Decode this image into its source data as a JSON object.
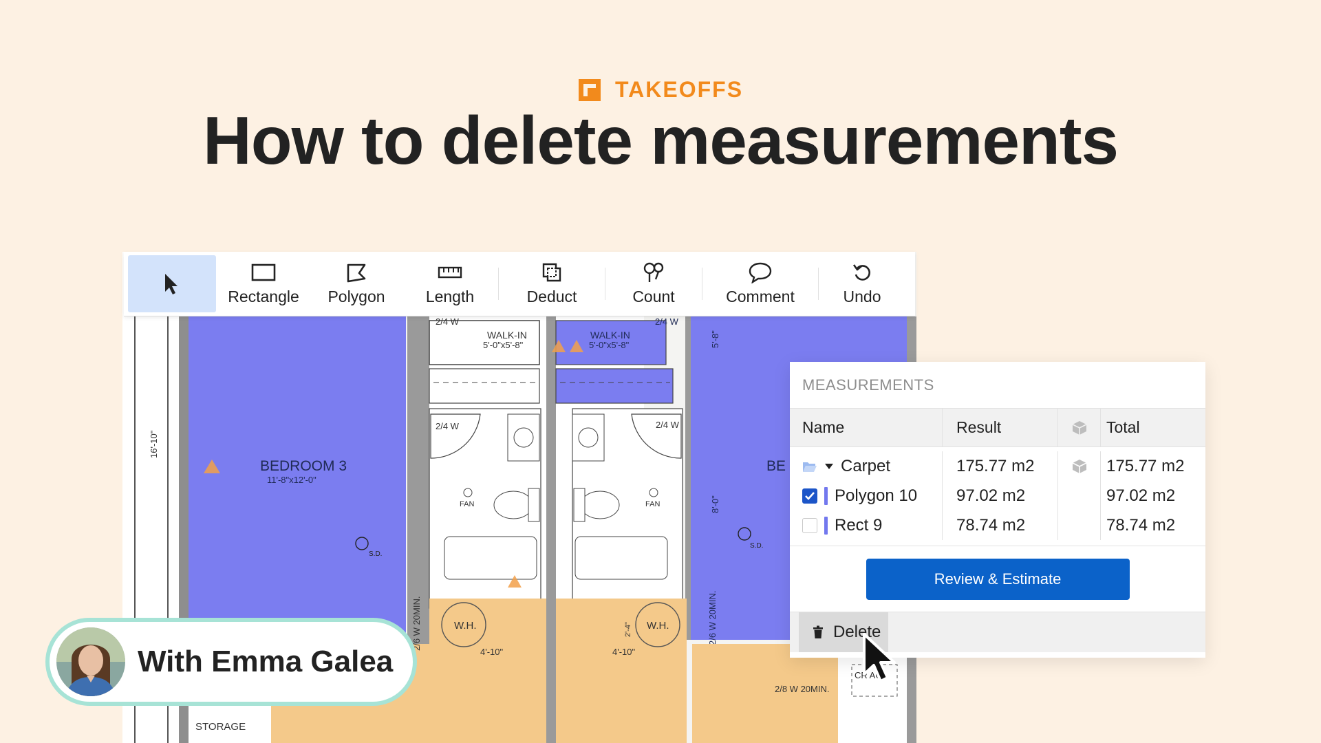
{
  "header": {
    "eyebrow": "TAKEOFFS",
    "title": "How to delete measurements"
  },
  "toolbar": {
    "tools": [
      {
        "label": "",
        "icon": "cursor-arrow-icon"
      },
      {
        "label": "Rectangle",
        "icon": "rectangle-icon"
      },
      {
        "label": "Polygon",
        "icon": "polygon-icon"
      },
      {
        "label": "Length",
        "icon": "ruler-icon"
      },
      {
        "label": "Deduct",
        "icon": "deduct-icon"
      },
      {
        "label": "Count",
        "icon": "count-icon"
      },
      {
        "label": "Comment",
        "icon": "comment-bubble-icon"
      },
      {
        "label": "Undo",
        "icon": "undo-icon"
      }
    ]
  },
  "plan": {
    "labels": {
      "bedroom3": "BEDROOM 3",
      "bedroom3_dims": "11'-8\"x12'-0\"",
      "bedroom_partial": "BE",
      "walkin": "WALK-IN",
      "walkin_dims": "5'-0\"x5'-8\"",
      "door_24w": "2/4 W",
      "fan": "FAN",
      "wh": "W.H.",
      "dim_16_10": "16'-10\"",
      "dim_8_0": "8'-0\"",
      "dim_5_8": "5'-8\"",
      "dim_4_10": "4'-10\"",
      "dim_2_4": "2'-4\"",
      "door_20min": "2/6 W 20MIN.",
      "door_28_20min": "2/8 W 20MIN.",
      "sd": "S.D.",
      "storage": "STORAGE",
      "crawl_access": "CR AC"
    },
    "colors": {
      "blue": "#7b7df0",
      "orange": "#f4c98a"
    }
  },
  "measurements": {
    "title": "MEASUREMENTS",
    "columns": {
      "name": "Name",
      "result": "Result",
      "total": "Total"
    },
    "rows": [
      {
        "name": "Carpet",
        "result": "175.77 m2",
        "total": "175.77 m2",
        "type": "folder"
      },
      {
        "name": "Polygon 10",
        "result": "97.02 m2",
        "total": "97.02 m2",
        "checked": true
      },
      {
        "name": "Rect 9",
        "result": "78.74 m2",
        "total": "78.74 m2",
        "checked": false
      }
    ],
    "primary_button": "Review & Estimate",
    "delete_button": "Delete"
  },
  "presenter": {
    "text": "With Emma Galea"
  },
  "colors": {
    "background": "#fdf1e3",
    "accent": "#f28a1c",
    "primary": "#0b62c9",
    "selected_tool": "#d3e3fb",
    "presenter_border": "#a7e3d6"
  }
}
